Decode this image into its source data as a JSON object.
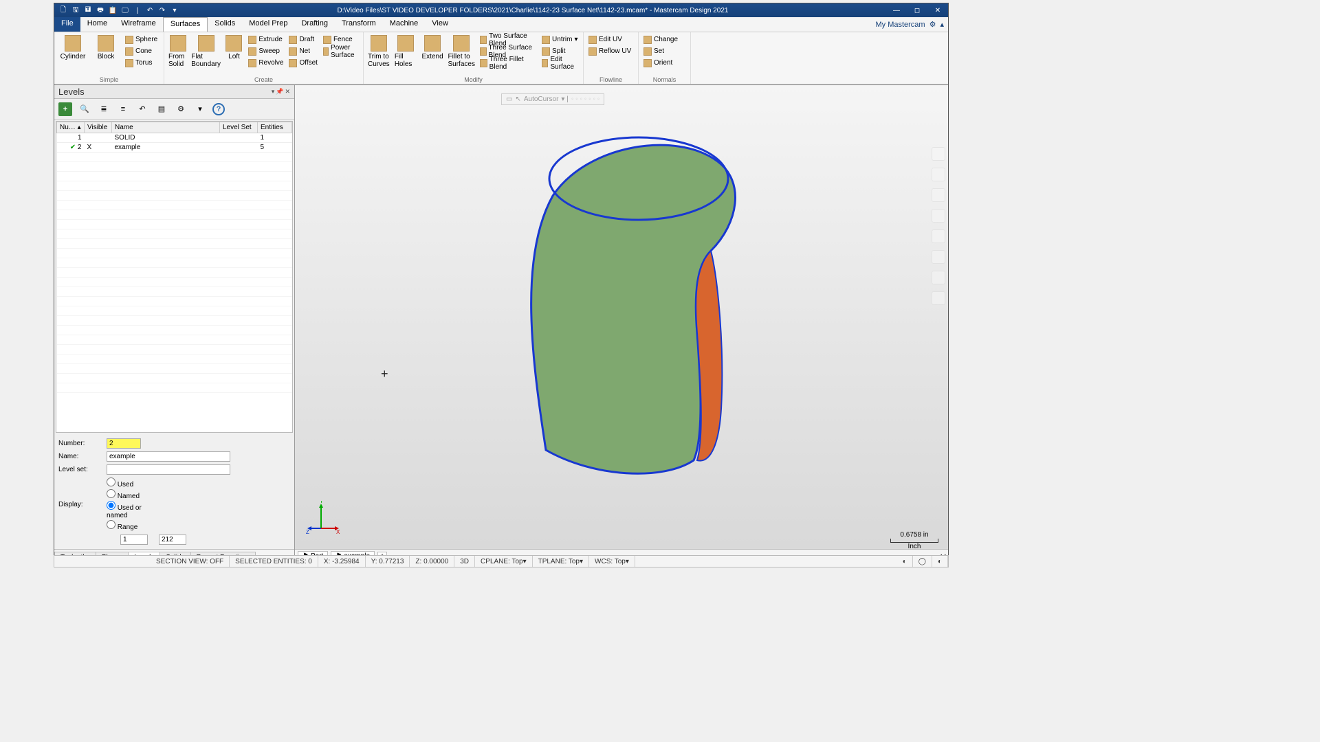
{
  "title": "D:\\Video Files\\ST VIDEO DEVELOPER FOLDERS\\2021\\Charlie\\1142-23 Surface Net\\1142-23.mcam* - Mastercam Design 2021",
  "menu": {
    "file": "File",
    "tabs": [
      "Home",
      "Wireframe",
      "Surfaces",
      "Solids",
      "Model Prep",
      "Drafting",
      "Transform",
      "Machine",
      "View"
    ],
    "active": "Surfaces",
    "my": "My Mastercam"
  },
  "ribbon": {
    "simple": {
      "label": "Simple",
      "cylinder": "Cylinder",
      "block": "Block",
      "sphere": "Sphere",
      "cone": "Cone",
      "torus": "Torus"
    },
    "create": {
      "label": "Create",
      "from_solid": "From Solid",
      "flat_boundary": "Flat Boundary",
      "loft": "Loft",
      "extrude": "Extrude",
      "sweep": "Sweep",
      "revolve": "Revolve",
      "draft": "Draft",
      "net": "Net",
      "offset": "Offset",
      "fence": "Fence",
      "power": "Power Surface"
    },
    "modify": {
      "label": "Modify",
      "trim": "Trim to Curves",
      "fill": "Fill Holes",
      "extend": "Extend",
      "fillet": "Fillet to Surfaces",
      "two_blend": "Two Surface Blend",
      "three_blend": "Three Surface Blend",
      "three_fillet": "Three Fillet Blend",
      "untrim": "Untrim",
      "split": "Split",
      "edit": "Edit Surface"
    },
    "flowline": {
      "label": "Flowline",
      "edituv": "Edit UV",
      "reflow": "Reflow UV"
    },
    "normals": {
      "label": "Normals",
      "change": "Change",
      "set": "Set",
      "orient": "Orient"
    }
  },
  "levels_panel": {
    "title": "Levels",
    "cols": {
      "num": "Nu…",
      "visible": "Visible",
      "name": "Name",
      "levelset": "Level Set",
      "entities": "Entities"
    },
    "rows": [
      {
        "num": "1",
        "visible": "",
        "name": "SOLID",
        "entities": "1",
        "active": false
      },
      {
        "num": "2",
        "visible": "X",
        "name": "example",
        "entities": "5",
        "active": true
      }
    ],
    "form": {
      "number_lbl": "Number:",
      "number": "2",
      "name_lbl": "Name:",
      "name": "example",
      "levelset_lbl": "Level set:",
      "levelset": "",
      "display_lbl": "Display:",
      "opt_used": "Used",
      "opt_named": "Named",
      "opt_used_or_named": "Used or named",
      "opt_range": "Range",
      "range_from": "1",
      "range_to": "212"
    }
  },
  "bottom_tabs": [
    "Toolpaths",
    "Planes",
    "Levels",
    "Solids",
    "Recent Functions"
  ],
  "bottom_tabs_active": "Levels",
  "viewport": {
    "autocursor": "AutoCursor",
    "tabs": {
      "part": "Part",
      "example": "example"
    },
    "scale_val": "0.6758 in",
    "scale_unit": "Inch",
    "gnomon": {
      "x": "X",
      "y": "Y",
      "z": "Z"
    }
  },
  "status": {
    "section": "SECTION VIEW: OFF",
    "selected": "SELECTED ENTITIES: 0",
    "x_lbl": "X:",
    "x": "-3.25984",
    "y_lbl": "Y:",
    "y": "0.77213",
    "z_lbl": "Z:",
    "z": "0.00000",
    "mode": "3D",
    "cplane": "CPLANE: Top",
    "tplane": "TPLANE: Top",
    "wcs": "WCS: Top"
  }
}
